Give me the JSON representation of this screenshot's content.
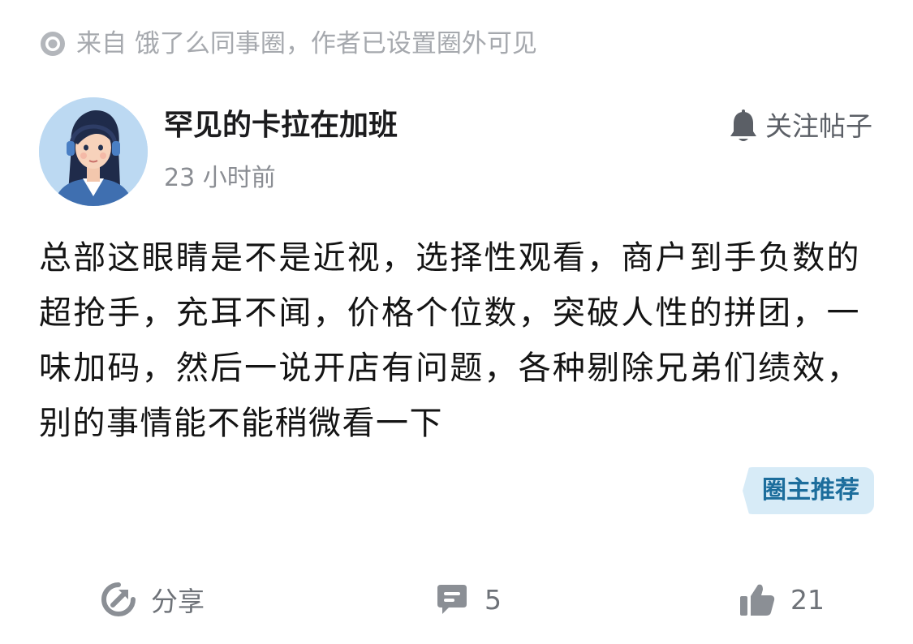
{
  "source": {
    "icon": "circle-dot-icon",
    "text": "来自 饿了么同事圈，作者已设置圈外可见"
  },
  "author": {
    "avatar": "avatar-woman-headset",
    "name": "罕见的卡拉在加班",
    "time": "23 小时前"
  },
  "follow": {
    "icon": "bell-icon",
    "label": "关注帖子"
  },
  "post": {
    "content": "总部这眼睛是不是近视，选择性观看，商户到手负数的超抢手，充耳不闻，价格个位数，突破人性的拼团，一味加码，然后一说开店有问题，各种剔除兄弟们绩效，别的事情能不能稍微看一下",
    "tag": "圈主推荐"
  },
  "actions": {
    "share": {
      "icon": "share-icon",
      "label": "分享"
    },
    "comment": {
      "icon": "comment-icon",
      "count": "5"
    },
    "like": {
      "icon": "thumbs-up-icon",
      "count": "21"
    }
  },
  "colors": {
    "muted_text": "#a6a9ae",
    "tag_bg": "#d7ebf7",
    "tag_text": "#1c6d9c",
    "action_icon": "#8b8f95"
  }
}
